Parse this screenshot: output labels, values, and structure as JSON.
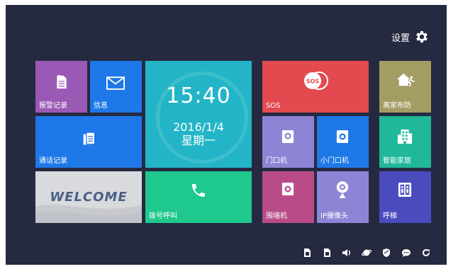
{
  "header": {
    "settings_label": "设置"
  },
  "clock": {
    "time": "15:40",
    "date": "2016/1/4",
    "weekday": "星期一"
  },
  "welcome": {
    "text": "WELCOME"
  },
  "tiles": {
    "alarm_log": "报警记录",
    "messages": "信息",
    "call_log": "通话记录",
    "dial": "拨号呼叫",
    "sos": "SOS",
    "sos_badge": "SOS",
    "door_unit": "门口机",
    "small_door_unit": "小门口机",
    "wall_unit": "围墙机",
    "ip_camera": "IP摄像头",
    "away_arm": "离家布防",
    "smart_home": "智能家居",
    "elevator": "呼梯"
  },
  "colors": {
    "background": "#262a40",
    "purple": "#9b59b6",
    "blue": "#1e78e8",
    "cyan": "#23b5c7",
    "green": "#1fc88c",
    "red": "#e24a4f",
    "lavender": "#8e84d6",
    "magenta": "#b94c88",
    "olive": "#a39c63",
    "teal": "#20b899",
    "indigo": "#4a4bbd"
  }
}
